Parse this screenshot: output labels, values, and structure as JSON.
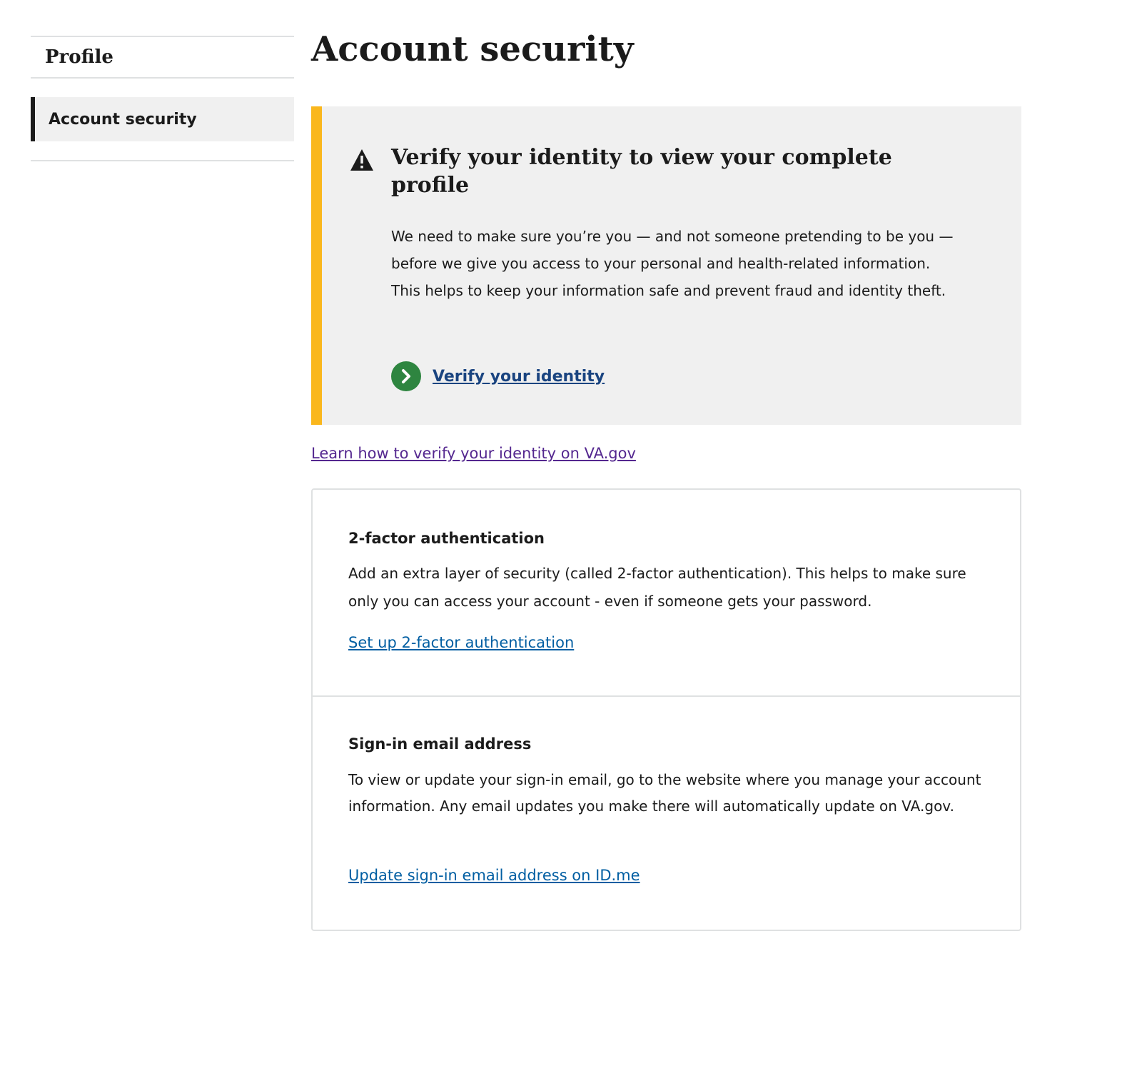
{
  "sidebar": {
    "heading": "Profile",
    "items": [
      {
        "label": "Account security",
        "active": true
      }
    ]
  },
  "page": {
    "title": "Account security"
  },
  "alert": {
    "status": "warning",
    "icon": "warning-icon",
    "accent_color": "#fab71d",
    "heading": "Verify your identity to view your complete profile",
    "body": "We need to make sure you’re you — and not someone pretending to be you — before we give you access to your personal and health-related information. This helps to keep your information safe and prevent fraud and identity theft.",
    "action": {
      "icon": "chevron-right-circle-icon",
      "label": "Verify your identity"
    }
  },
  "learn_link": {
    "label": "Learn how to verify your identity on VA.gov"
  },
  "sections": [
    {
      "title": "2-factor authentication",
      "body": "Add an extra layer of security (called 2-factor authentication). This helps to make sure only you can access your account - even if someone gets your password.",
      "link": "Set up 2-factor authentication"
    },
    {
      "title": "Sign-in email address",
      "body": "To view or update your sign-in email, go to the website where you manage your account information. Any email updates you make there will automatically update on VA.gov.",
      "link": "Update sign-in email address on ID.me"
    }
  ],
  "colors": {
    "link": "#005ea2",
    "link_visited": "#54278f",
    "action_green": "#2e8540",
    "alert_background": "#f0f0f0"
  }
}
